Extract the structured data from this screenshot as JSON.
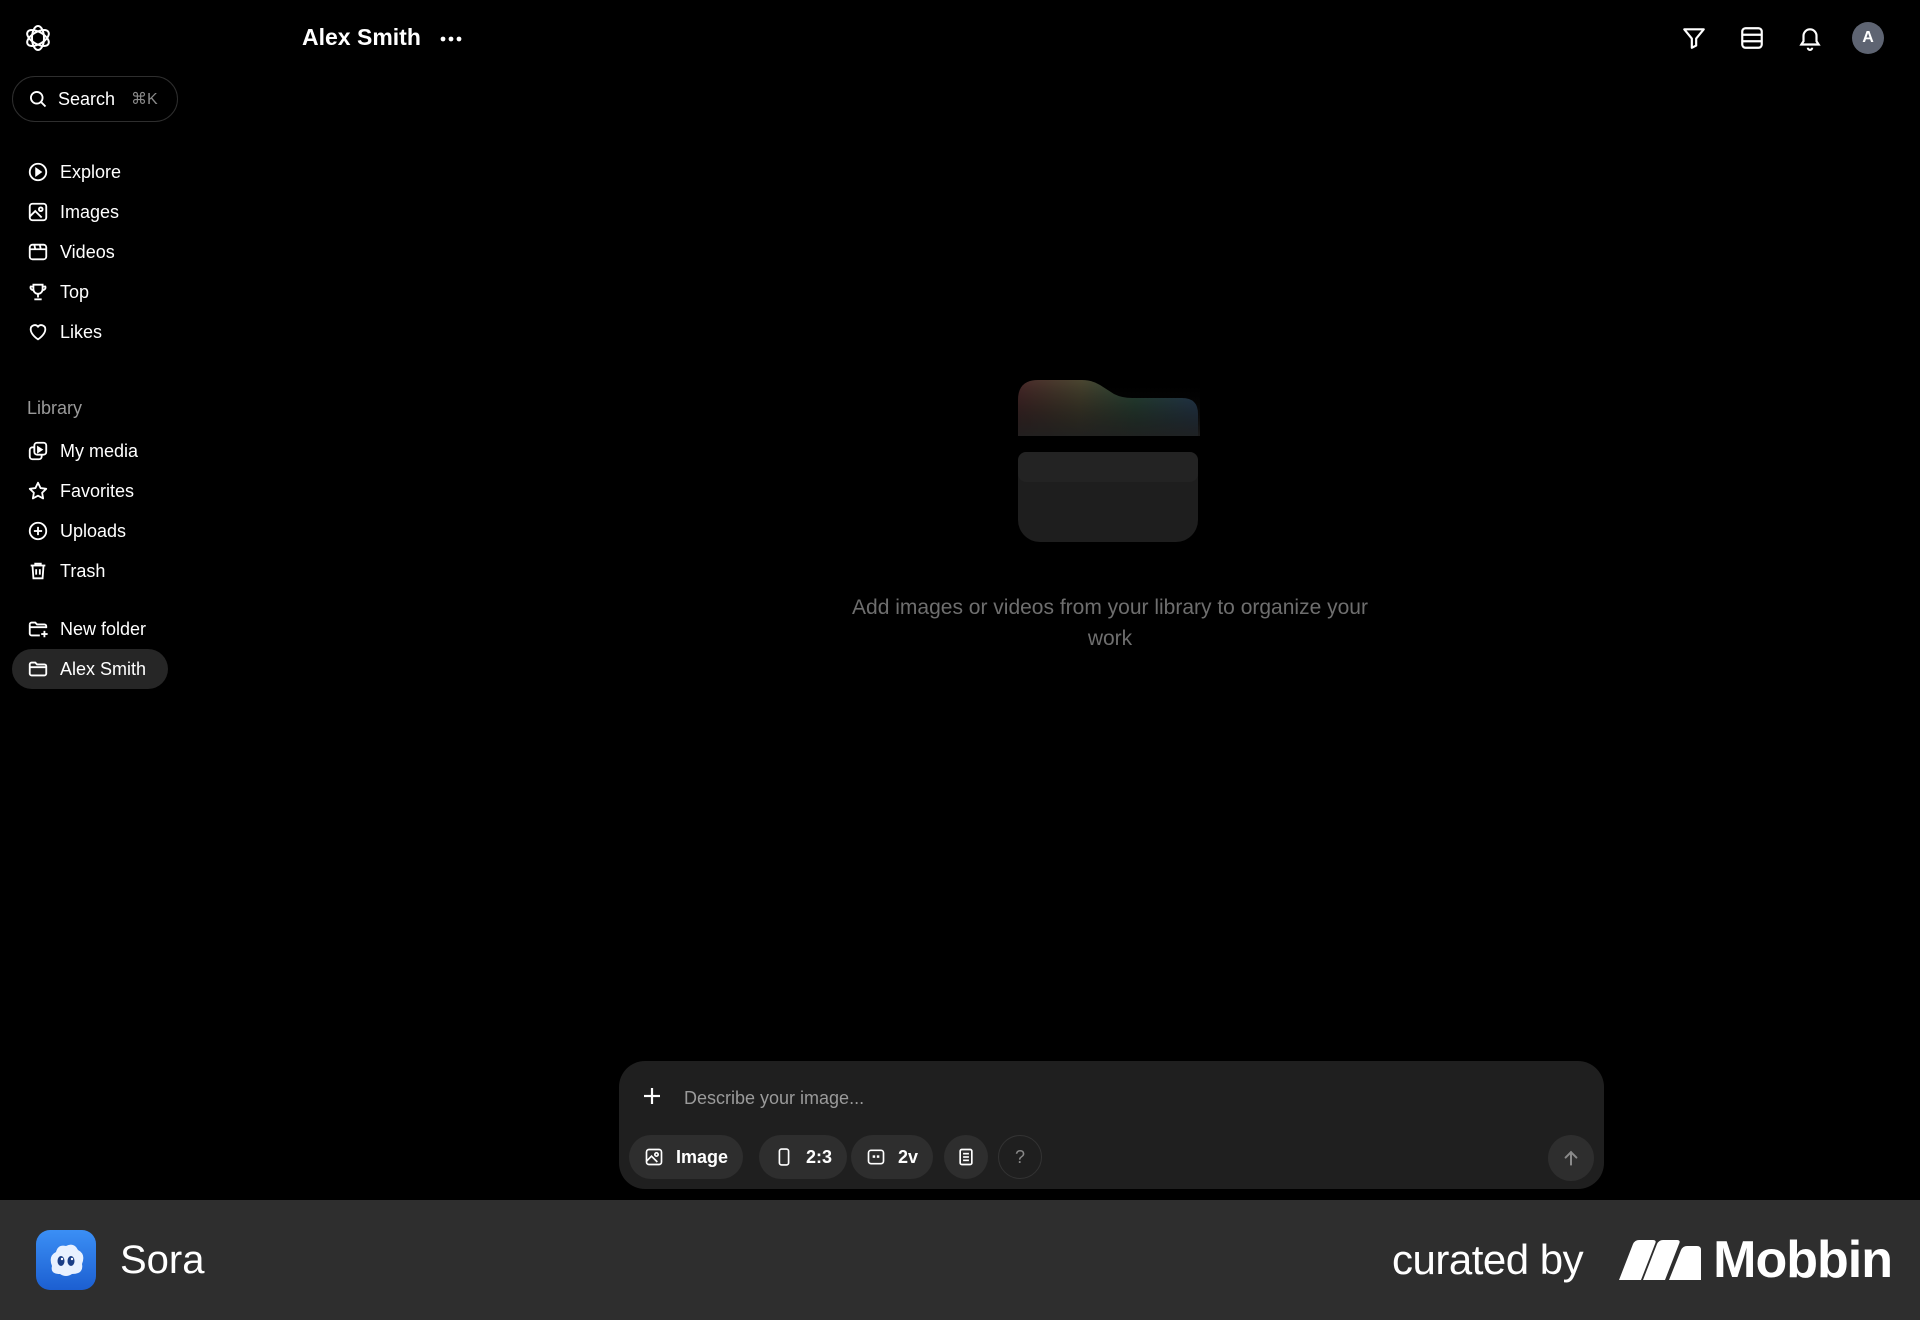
{
  "app": {
    "logo_icon": "openai-logo-icon"
  },
  "sidebar": {
    "search": {
      "label": "Search",
      "shortcut": "⌘K"
    },
    "nav": [
      {
        "label": "Explore",
        "icon": "explore-icon"
      },
      {
        "label": "Images",
        "icon": "image-icon"
      },
      {
        "label": "Videos",
        "icon": "video-icon"
      },
      {
        "label": "Top",
        "icon": "trophy-icon"
      },
      {
        "label": "Likes",
        "icon": "heart-icon"
      }
    ],
    "library_label": "Library",
    "library": [
      {
        "label": "My media",
        "icon": "media-icon"
      },
      {
        "label": "Favorites",
        "icon": "star-icon"
      },
      {
        "label": "Uploads",
        "icon": "upload-icon"
      },
      {
        "label": "Trash",
        "icon": "trash-icon"
      }
    ],
    "folders": [
      {
        "label": "New folder",
        "icon": "folder-plus-icon"
      },
      {
        "label": "Alex Smith",
        "icon": "folder-icon",
        "active": true
      }
    ]
  },
  "header": {
    "title": "Alex Smith",
    "more_icon": "more-horizontal-icon",
    "actions": [
      "filter-icon",
      "layout-icon",
      "bell-icon"
    ],
    "avatar_initial": "A"
  },
  "empty_state": {
    "icon": "empty-folder-icon",
    "message": "Add images or videos from your library to organize your work"
  },
  "composer": {
    "placeholder": "Describe your image...",
    "value": "",
    "media_type": "Image",
    "aspect_ratio": "2:3",
    "variations": "2v",
    "help": "?"
  },
  "footer": {
    "app_name": "Sora",
    "curated_by": "curated by",
    "brand": "Mobbin"
  },
  "colors": {
    "background": "#000000",
    "sidebar_active": "#262626",
    "composer_bg": "#1f1f1f",
    "chip_bg": "#2e2e2e",
    "footer_bg": "#2e2e2e",
    "muted_text": "#6e6e6e"
  }
}
